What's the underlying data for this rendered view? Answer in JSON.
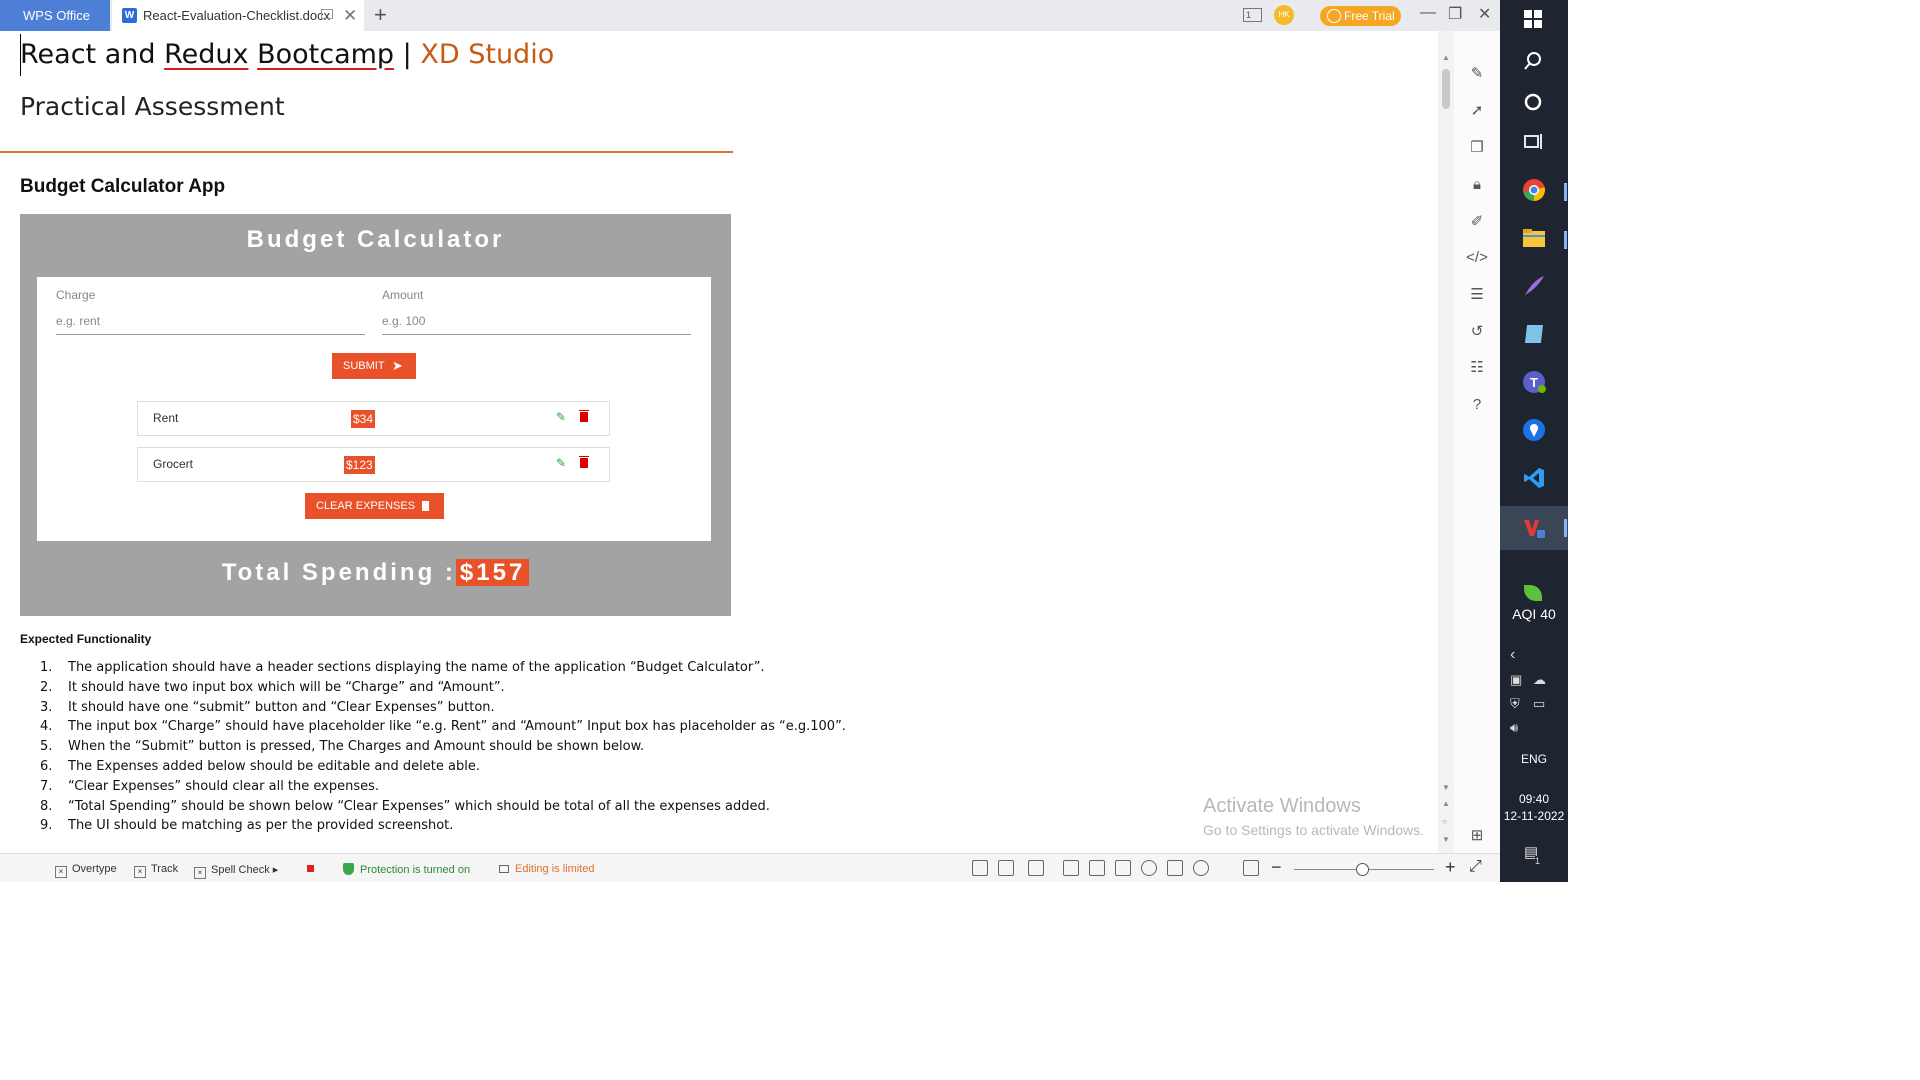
{
  "tabs": {
    "app_name": "WPS Office",
    "document_tab": "React-Evaluation-Checklist.docx",
    "doc_icon_letter": "W",
    "page_count_badge": "1"
  },
  "header": {
    "avatar_initials": "HK",
    "free_trial_label": "Free Trial"
  },
  "document": {
    "title_part1": "React and ",
    "title_redux": "Redux",
    "title_space": " ",
    "title_bootcamp": "Bootcamp",
    "title_sep": " | ",
    "title_brand": "XD Studio",
    "subtitle": "Practical Assessment",
    "section_heading": "Budget Calculator App",
    "expected_heading": "Expected Functionality",
    "requirements": [
      {
        "num": "1.",
        "text": "The application should have a header sections displaying the name of the application “Budget Calculator”."
      },
      {
        "num": "2.",
        "text": "It should have two input box which will be “Charge” and “Amount”."
      },
      {
        "num": "3.",
        "text": "It should have one “submit” button and “Clear Expenses” button."
      },
      {
        "num": "4.",
        "text": "The input box “Charge” should have placeholder like “e.g. Rent” and “Amount” Input box has placeholder as “e.g.100”."
      },
      {
        "num": "5.",
        "text": "When the “Submit” button is pressed, The Charges and Amount should be shown below."
      },
      {
        "num": "6.",
        "text": "The Expenses added below should be editable and delete able."
      },
      {
        "num": "7.",
        "text": "“Clear Expenses” should clear all the expenses."
      },
      {
        "num": "8.",
        "text": "“Total Spending” should be shown below “Clear Expenses” which should be total of all the expenses added."
      },
      {
        "num": "9.",
        "text": "The UI should be matching as per the provided screenshot."
      }
    ]
  },
  "budget_app": {
    "title": "Budget Calculator",
    "charge_label": "Charge",
    "charge_placeholder": "e.g. rent",
    "amount_label": "Amount",
    "amount_placeholder": "e.g. 100",
    "submit_label": "SUBMIT",
    "expenses": [
      {
        "name": "Rent",
        "amount": "$34"
      },
      {
        "name": "Grocert",
        "amount": "$123"
      }
    ],
    "clear_label": "CLEAR EXPENSES",
    "total_label": "Total Spending :",
    "total_value": "$157"
  },
  "watermark": {
    "line1": "Activate Windows",
    "line2": "Go to Settings to activate Windows."
  },
  "statusbar": {
    "overtype": "Overtype",
    "track": "Track",
    "spell_check": "Spell Check",
    "protection": "Protection is turned on",
    "editing": "Editing is limited"
  },
  "taskbar": {
    "aqi": "AQI 40",
    "language": "ENG",
    "time": "09:40",
    "date": "12-11-2022",
    "notification_count": "1"
  },
  "colors": {
    "accent_orange": "#e8512a",
    "brand_orange": "#c55a11",
    "wps_blue": "#4d7fd6",
    "free_trial": "#f5a623"
  }
}
